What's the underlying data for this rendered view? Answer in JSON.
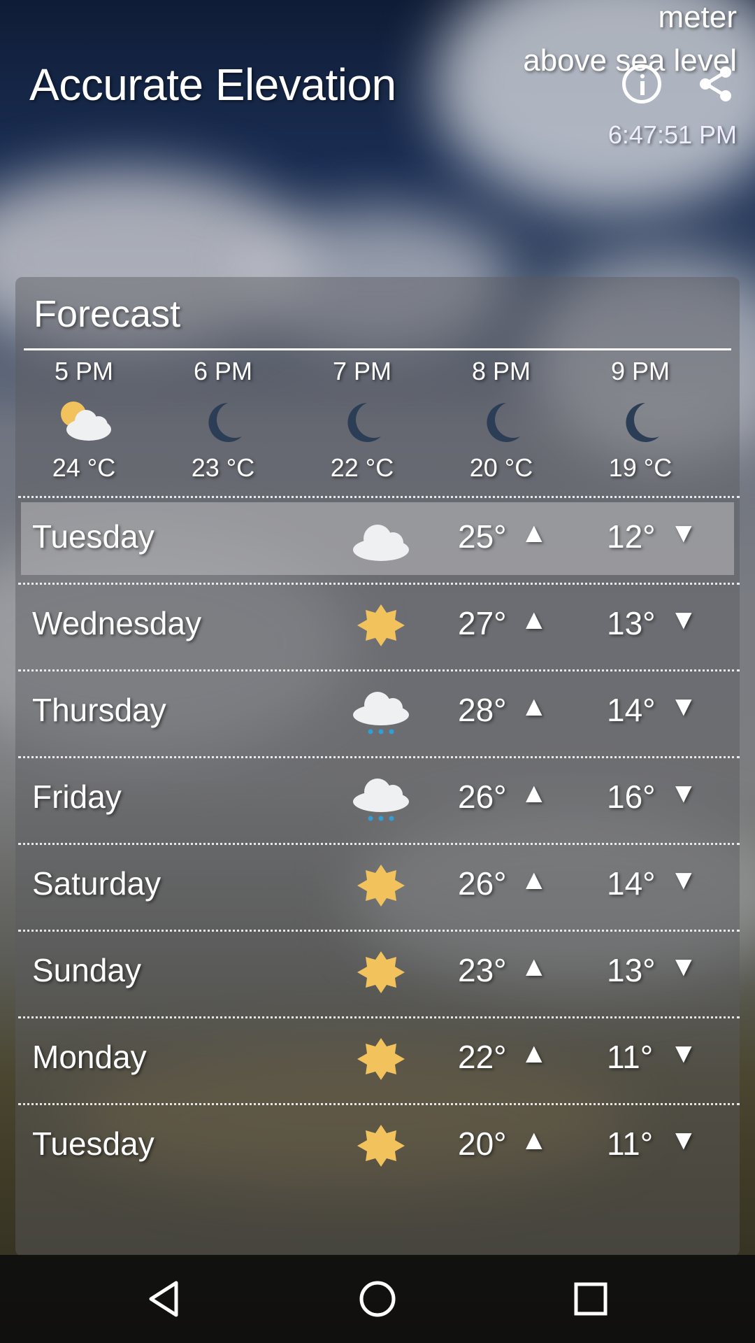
{
  "header": {
    "app_title": "Accurate Elevation",
    "unit_line1": "meter",
    "unit_line2": "above sea level",
    "time": "6:47:51 PM",
    "info_icon": "info-icon",
    "share_icon": "share-icon"
  },
  "forecast": {
    "title": "Forecast",
    "hourly": [
      {
        "time": "5 PM",
        "temp": "24 °C",
        "icon": "partly-cloudy-icon"
      },
      {
        "time": "6 PM",
        "temp": "23 °C",
        "icon": "moon-icon"
      },
      {
        "time": "7 PM",
        "temp": "22 °C",
        "icon": "moon-icon"
      },
      {
        "time": "8 PM",
        "temp": "20 °C",
        "icon": "moon-icon"
      },
      {
        "time": "9 PM",
        "temp": "19 °C",
        "icon": "moon-icon"
      }
    ],
    "daily": [
      {
        "day": "Tuesday",
        "icon": "cloud-icon",
        "high": "25°",
        "low": "12°",
        "up": "▲",
        "down": "▼"
      },
      {
        "day": "Wednesday",
        "icon": "sun-icon",
        "high": "27°",
        "low": "13°",
        "up": "▲",
        "down": "▼"
      },
      {
        "day": "Thursday",
        "icon": "rain-icon",
        "high": "28°",
        "low": "14°",
        "up": "▲",
        "down": "▼"
      },
      {
        "day": "Friday",
        "icon": "rain-icon",
        "high": "26°",
        "low": "16°",
        "up": "▲",
        "down": "▼"
      },
      {
        "day": "Saturday",
        "icon": "sun-icon",
        "high": "26°",
        "low": "14°",
        "up": "▲",
        "down": "▼"
      },
      {
        "day": "Sunday",
        "icon": "sun-icon",
        "high": "23°",
        "low": "13°",
        "up": "▲",
        "down": "▼"
      },
      {
        "day": "Monday",
        "icon": "sun-icon",
        "high": "22°",
        "low": "11°",
        "up": "▲",
        "down": "▼"
      },
      {
        "day": "Tuesday",
        "icon": "sun-icon",
        "high": "20°",
        "low": "11°",
        "up": "▲",
        "down": "▼"
      }
    ]
  },
  "navbar": {
    "back_icon": "back-triangle-icon",
    "home_icon": "home-circle-icon",
    "recents_icon": "recents-square-icon"
  },
  "colors": {
    "sun": "#f2c35c",
    "moon": "#2c3e56",
    "cloud": "#eef0f2",
    "rain": "#2f9fd8"
  }
}
